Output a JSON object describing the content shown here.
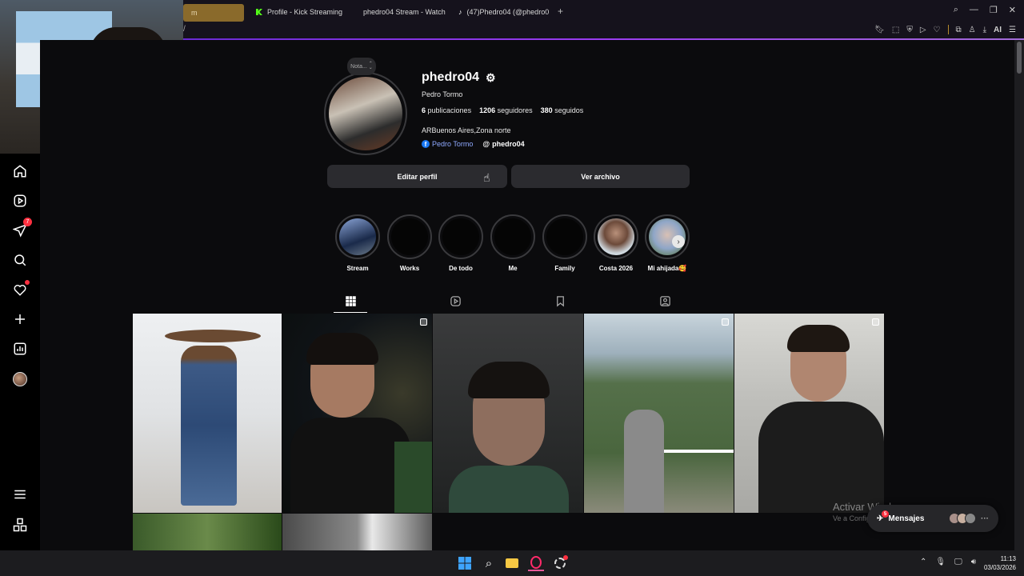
{
  "browser": {
    "tabs": [
      {
        "label": "m"
      },
      {
        "label": "Profile - Kick Streaming"
      },
      {
        "label": "phedro04 Stream - Watch"
      },
      {
        "label": "(47)Phedro04 (@phedro0"
      }
    ],
    "address_fragment": "/",
    "ai_label": "AI"
  },
  "profile": {
    "note_label": "Nota...",
    "username": "phedro04",
    "full_name": "Pedro Tormo",
    "posts_count": "6",
    "posts_label": "publicaciones",
    "followers_count": "1206",
    "followers_label": "seguidores",
    "following_count": "380",
    "following_label": "seguidos",
    "bio": "ARBuenos Aires,Zona norte",
    "facebook_link": "Pedro Tormo",
    "threads_link": "phedro04",
    "edit_button": "Editar perfil",
    "archive_button": "Ver archivo"
  },
  "highlights": [
    {
      "label": "Stream"
    },
    {
      "label": "Works"
    },
    {
      "label": "De todo"
    },
    {
      "label": "Me"
    },
    {
      "label": "Family"
    },
    {
      "label": "Costa 2026"
    },
    {
      "label": "Mi ahijada🥰"
    }
  ],
  "nav": {
    "notifications_badge": "7"
  },
  "messages": {
    "label": "Mensajes",
    "badge": "5"
  },
  "watermark": {
    "line1": "Activar Windows",
    "line2": "Ve a Configuración para activar Windows."
  },
  "clock": {
    "time": "11:13",
    "date": "03/03/2026"
  }
}
